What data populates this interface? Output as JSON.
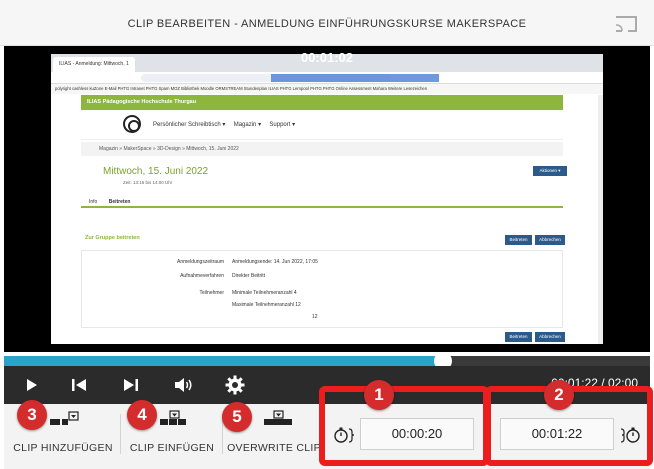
{
  "window": {
    "title": "CLIP BEARBEITEN - ANMELDUNG EINFÜHRUNGSKURSE MAKERSPACE"
  },
  "player": {
    "timecode": "00:01:02",
    "progress_fraction": 0.68,
    "time_display": "00:01:22 / 02:00",
    "buttons": {
      "play": "play-icon",
      "previous": "skip-previous-icon",
      "next": "skip-next-icon",
      "volume": "volume-icon",
      "settings": "gear-icon"
    }
  },
  "video_content": {
    "browser_tab": "ILIAS - Anmeldung: Mittwoch, 1",
    "bookmarks": "polyright cashless   kuZone   E-Mail PHTG   Intranet PHTG   Spam   MOZ Bibliothek   Moodle   ORMSTREAM   Stundenplan   ILIAS PHTG   Lernpool PHTG   PHTG Online Assessment   Mahara   Weitere Lesezeichen",
    "site_title": "ILIAS Pädagogische Hochschule Thurgau",
    "nav_items": [
      "Persönlicher Schreibtisch ▾",
      "Magazin ▾",
      "Support ▾"
    ],
    "breadcrumb": "Magazin  »  MakerSpace  »  3D-Design  »  Mittwoch, 15. Juni 2022",
    "heading": "Mittwoch, 15. Juni 2022",
    "subheading": "Zeit: 13:15 bis 14:00 Uhr",
    "actions_button": "Aktionen ▾",
    "tabs": [
      "Info",
      "Beitreten"
    ],
    "join_group": "Zur Gruppe beitreten",
    "join_button": "Beitreten",
    "cancel_button": "Abbrechen",
    "rows": [
      {
        "label": "Anmeldungszeitraum",
        "value": "Anmeldungsende:  14. Jun 2022, 17:05"
      },
      {
        "label": "Aufnahmeverfahren",
        "value": "Direkter Beitritt"
      },
      {
        "label": "Teilnehmer",
        "value": "Minimale Teilnehmeranzahl    4"
      },
      {
        "label": "",
        "value": "Maximale Teilnehmeranzahl    12"
      },
      {
        "label": "",
        "value": "12"
      }
    ]
  },
  "clip_toolbar": {
    "add_clip": "CLIP HINZUFÜGEN",
    "insert_clip": "CLIP EINFÜGEN",
    "overwrite_clip": "OVERWRITE CLIP",
    "start_time": "00:00:20",
    "end_time": "00:01:22"
  },
  "annotations": {
    "badges": [
      "1",
      "2",
      "3",
      "4",
      "5"
    ],
    "color": "#ec1d1d"
  }
}
